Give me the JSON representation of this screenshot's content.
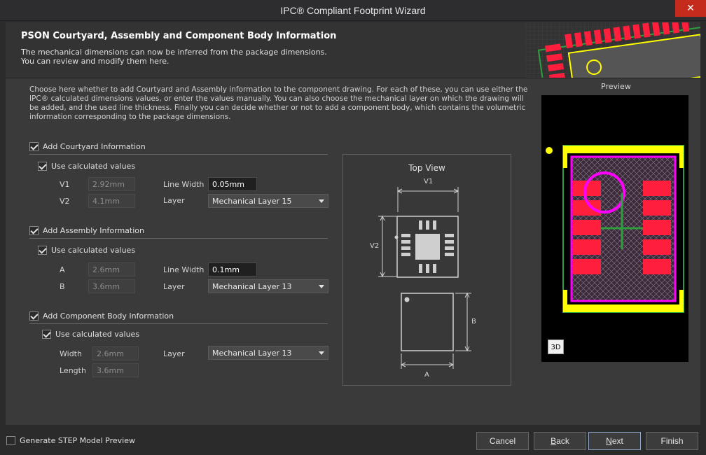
{
  "window": {
    "title": "IPC® Compliant Footprint Wizard",
    "close_glyph": "✕"
  },
  "header": {
    "title": "PSON Courtyard, Assembly and Component Body Information",
    "desc_line1": "The mechanical dimensions can now be inferred from the package dimensions.",
    "desc_line2": "You can review and modify them here."
  },
  "intro": "Choose here whether to add Courtyard and Assembly information to the component drawing. For each of these, you can use either the IPC® calculated dimensions values, or enter the values manually. You can also choose the mechanical layer on which the drawing will be added, and the used line thickness. Finally you can decide whether or not to add a component body, which contains the volumetric information corresponding to the package dimensions.",
  "courtyard": {
    "label": "Add Courtyard Information",
    "use_calc": "Use calculated values",
    "v1_label": "V1",
    "v1_value": "2.92mm",
    "v2_label": "V2",
    "v2_value": "4.1mm",
    "line_width_label": "Line Width",
    "line_width_value": "0.05mm",
    "layer_label": "Layer",
    "layer_value": "Mechanical Layer 15"
  },
  "assembly": {
    "label": "Add Assembly Information",
    "use_calc": "Use calculated values",
    "a_label": "A",
    "a_value": "2.6mm",
    "b_label": "B",
    "b_value": "3.6mm",
    "line_width_label": "Line Width",
    "line_width_value": "0.1mm",
    "layer_label": "Layer",
    "layer_value": "Mechanical Layer 13"
  },
  "body": {
    "label": "Add Component Body Information",
    "use_calc": "Use calculated values",
    "width_label": "Width",
    "width_value": "2.6mm",
    "length_label": "Length",
    "length_value": "3.6mm",
    "layer_label": "Layer",
    "layer_value": "Mechanical Layer 13"
  },
  "topview": {
    "title": "Top View",
    "v1": "V1",
    "v2": "V2",
    "a": "A",
    "b": "B"
  },
  "preview": {
    "label": "Preview",
    "btn_3d": "3D"
  },
  "footer": {
    "step_preview": "Generate STEP Model Preview",
    "cancel": "Cancel",
    "back_u": "B",
    "back_rest": "ack",
    "next_u": "N",
    "next_rest": "ext",
    "finish": "Finish"
  },
  "colors": {
    "pad_red": "#ff1f3d",
    "magenta": "#ff00ff",
    "yellow": "#ffff00",
    "green": "#2e9e3e"
  }
}
